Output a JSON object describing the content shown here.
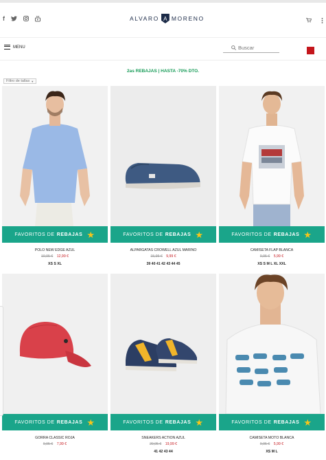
{
  "header": {
    "social": [
      "facebook-icon",
      "twitter-icon",
      "instagram-icon",
      "youtube-icon"
    ],
    "logo_left": "ALVARO",
    "logo_mark": "A",
    "logo_right": "MORENO",
    "cart_icon": "cart-icon",
    "more_icon": "more-vertical-icon"
  },
  "menubar": {
    "menu_label": "MENU",
    "search_placeholder": "Buscar"
  },
  "promo": {
    "text": "2as REBAJAS | HASTA -70% DTO."
  },
  "filter": {
    "label": "Filtro de tallas"
  },
  "colors": {
    "accent": "#1aa58a",
    "sale": "#c4161c",
    "promo": "#169b57",
    "star": "#f7c51a"
  },
  "products": [
    {
      "name": "POLO NEW EDGE AZUL",
      "old_price": "19,95 €",
      "price": "12,99 €",
      "sizes": "XS S XL",
      "banner_pre": "FAVORITOS DE",
      "banner_bold": "REBAJAS"
    },
    {
      "name": "ALPARGATAS CROWELL AZUL MARINO",
      "old_price": "15,95 €",
      "price": "9,99 €",
      "sizes": "39 40 41 42 43 44 45",
      "banner_pre": "FAVORITOS DE",
      "banner_bold": "REBAJAS"
    },
    {
      "name": "CAMISETA FLAP BLANCA",
      "old_price": "9,95 €",
      "price": "5,99 €",
      "sizes": "XS S M L XL XXL",
      "banner_pre": "FAVORITOS DE",
      "banner_bold": "REBAJAS"
    },
    {
      "name": "GORRA CLASSIC ROJA",
      "old_price": "9,95 €",
      "price": "7,99 €",
      "sizes": "",
      "banner_pre": "FAVORITOS DE",
      "banner_bold": "REBAJAS"
    },
    {
      "name": "SNEAKERS ACTION AZUL",
      "old_price": "29,95 €",
      "price": "19,99 €",
      "sizes": "41 42 43 44",
      "banner_pre": "FAVORITOS DE",
      "banner_bold": "REBAJAS"
    },
    {
      "name": "CAMISETA MOTO BLANCA",
      "old_price": "9,95 €",
      "price": "5,99 €",
      "sizes": "XS M L",
      "banner_pre": "FAVORITOS DE",
      "banner_bold": "REBAJAS"
    }
  ]
}
